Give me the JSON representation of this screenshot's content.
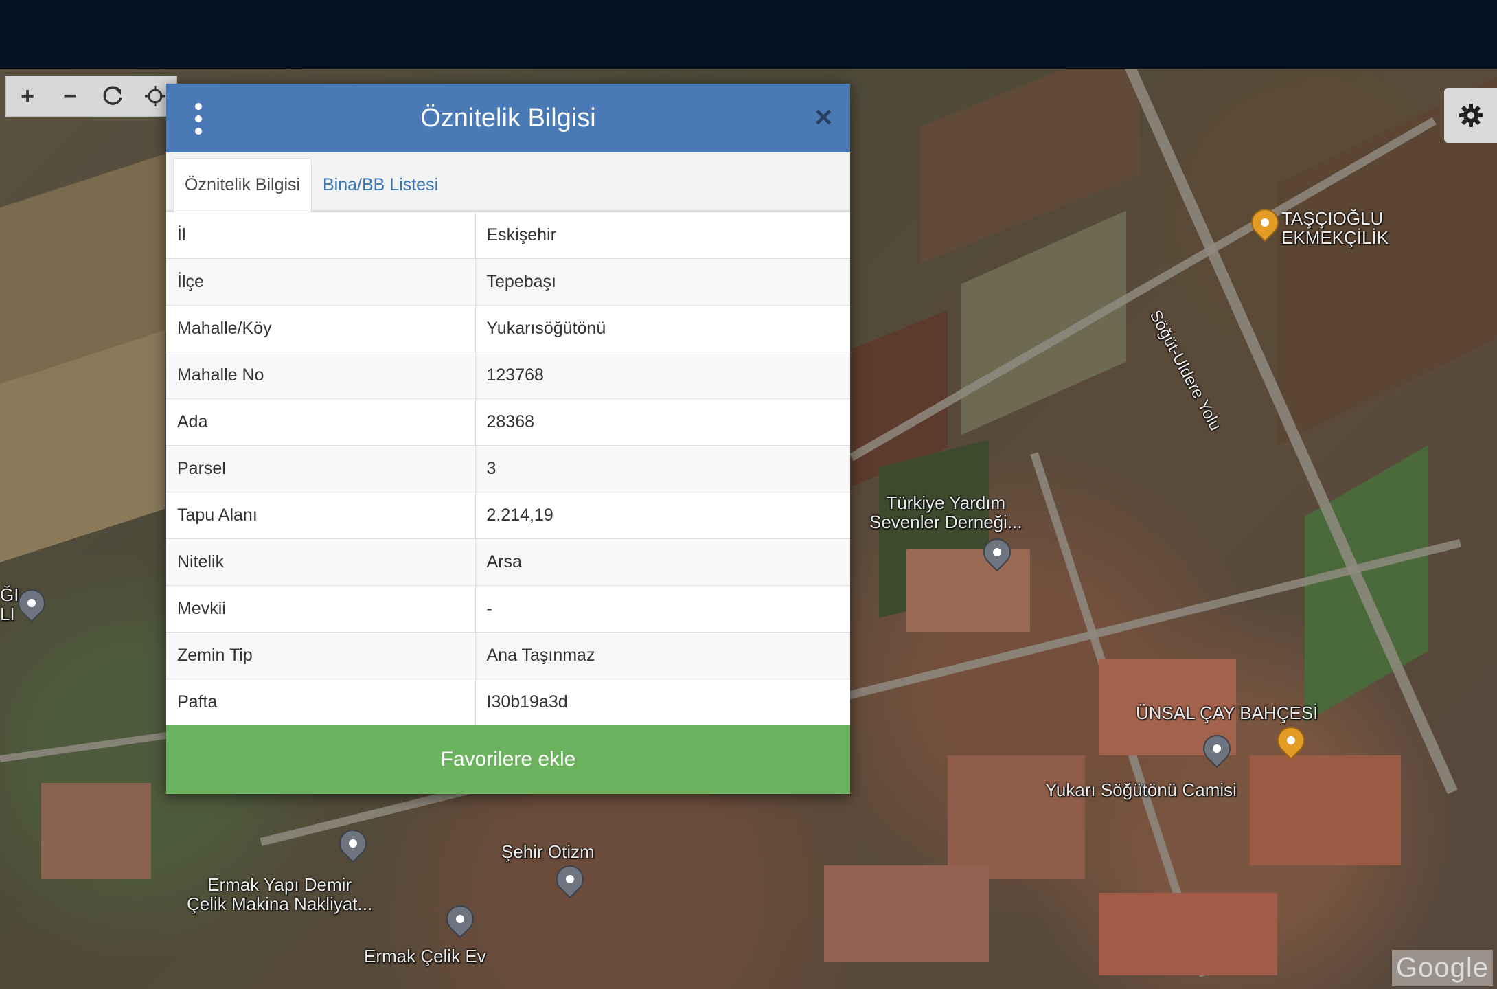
{
  "dialog": {
    "title": "Öznitelik Bilgisi",
    "close": "×",
    "tabs": [
      {
        "label": "Öznitelik Bilgisi"
      },
      {
        "label": "Bina/BB Listesi"
      }
    ],
    "rows": [
      {
        "key": "İl",
        "value": "Eskişehir"
      },
      {
        "key": "İlçe",
        "value": "Tepebaşı"
      },
      {
        "key": "Mahalle/Köy",
        "value": "Yukarısöğütönü"
      },
      {
        "key": "Mahalle No",
        "value": "123768"
      },
      {
        "key": "Ada",
        "value": "28368"
      },
      {
        "key": "Parsel",
        "value": "3"
      },
      {
        "key": "Tapu Alanı",
        "value": "2.214,19"
      },
      {
        "key": "Nitelik",
        "value": "Arsa"
      },
      {
        "key": "Mevkii",
        "value": "-"
      },
      {
        "key": "Zemin Tip",
        "value": "Ana Taşınmaz"
      },
      {
        "key": "Pafta",
        "value": "I30b19a3d"
      }
    ],
    "favorite_button": "Favorilere ekle"
  },
  "map": {
    "labels": {
      "ekmekcilik_1": "TAŞÇIOĞLU",
      "ekmekcilik_2": "EKMEKÇİLİK",
      "road": "Söğüt-Ulderе Yolu",
      "dernek_1": "Türkiye Yardım",
      "dernek_2": "Sevenler Derneği...",
      "cay_bahcesi": "ÜNSAL ÇAY BAHÇESİ",
      "camisi": "Yukarı Söğütönü Camisi",
      "otizm": "Şehir Otizm",
      "ermak_yapi_1": "Ermak Yapı Demir",
      "ermak_yapi_2": "Çelik Makina Nakliyat...",
      "ermak_celik": "Ermak Çelik Ev",
      "left_edge_1": "ĞI",
      "left_edge_2": "LI"
    },
    "attribution": "Google"
  },
  "toolbar": {
    "zoom_in": "+",
    "zoom_out": "−"
  },
  "colors": {
    "header": "#4a7ab5",
    "tab_link": "#3a76b5",
    "favorite": "#6cb35f",
    "topbar": "#061221"
  }
}
